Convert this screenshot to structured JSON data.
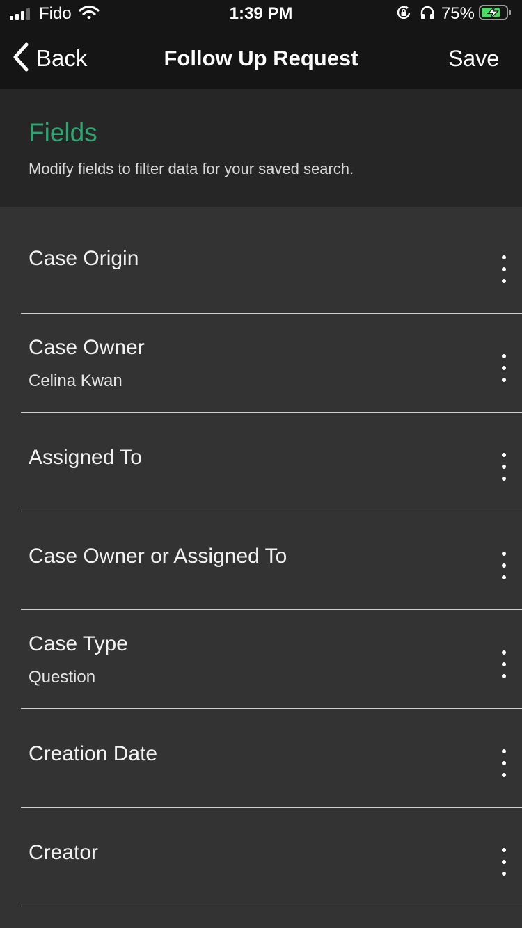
{
  "status_bar": {
    "carrier": "Fido",
    "time": "1:39 PM",
    "battery_percent": "75%",
    "icons": [
      "signal-icon",
      "wifi-icon",
      "orientation-lock-icon",
      "headphones-icon",
      "battery-charging-icon"
    ]
  },
  "nav": {
    "back_label": "Back",
    "title": "Follow Up Request",
    "save_label": "Save"
  },
  "fields_section": {
    "title": "Fields",
    "subtitle": "Modify fields to filter data for your saved search.",
    "title_color": "#2ea672"
  },
  "fields": [
    {
      "label": "Case Origin",
      "value": ""
    },
    {
      "label": "Case Owner",
      "value": "Celina Kwan"
    },
    {
      "label": "Assigned To",
      "value": ""
    },
    {
      "label": "Case Owner or Assigned To",
      "value": ""
    },
    {
      "label": "Case Type",
      "value": "Question"
    },
    {
      "label": "Creation Date",
      "value": ""
    },
    {
      "label": "Creator",
      "value": ""
    }
  ]
}
